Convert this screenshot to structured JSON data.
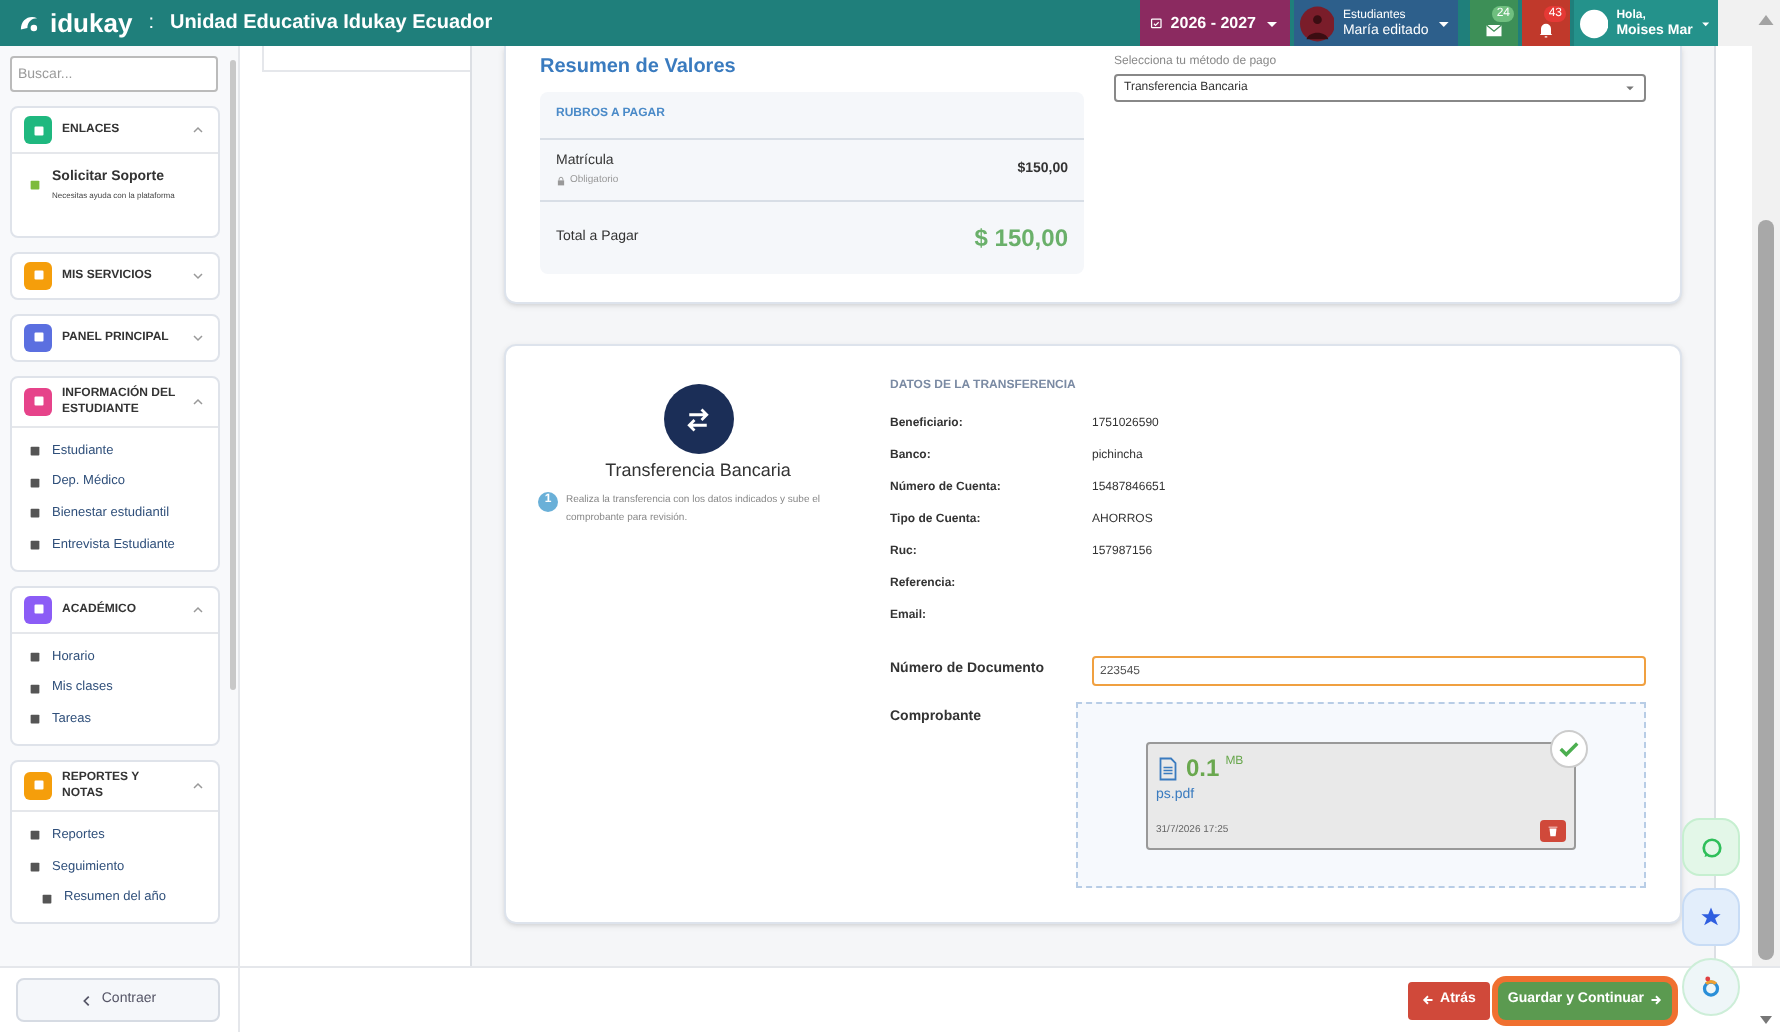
{
  "header": {
    "app_name": "idukay",
    "separator": ":",
    "institution": "Unidad Educativa Idukay Ecuador",
    "year": "2026 - 2027",
    "student_label": "Estudiantes",
    "student_name": "María editado",
    "messages_count": "24",
    "notifications_count": "43",
    "greeting": "Hola,",
    "user_name": "Moises Mar"
  },
  "sidebar": {
    "search": {
      "placeholder": "Buscar..."
    },
    "sections": [
      {
        "title": "ENLACES",
        "color": "#1fb87f",
        "expanded": true,
        "items": [
          {
            "label": "Solicitar Soporte",
            "subtitle": "Necesitas ayuda con la plataforma"
          }
        ]
      },
      {
        "title": "MIS SERVICIOS",
        "color": "#f59e0b",
        "expanded": false
      },
      {
        "title": "PANEL PRINCIPAL",
        "color": "#5b6fe0",
        "expanded": false
      },
      {
        "title": "INFORMACIÓN DEL ESTUDIANTE",
        "color": "#e6438a",
        "expanded": true,
        "items": [
          {
            "label": "Estudiante"
          },
          {
            "label": "Dep. Médico"
          },
          {
            "label": "Bienestar estudiantil"
          },
          {
            "label": "Entrevista Estudiante"
          }
        ]
      },
      {
        "title": "ACADÉMICO",
        "color": "#8b5cf6",
        "expanded": true,
        "items": [
          {
            "label": "Horario"
          },
          {
            "label": "Mis clases"
          },
          {
            "label": "Tareas"
          }
        ]
      },
      {
        "title": "REPORTES Y NOTAS",
        "color": "#f59e0b",
        "expanded": true,
        "items": [
          {
            "label": "Reportes"
          },
          {
            "label": "Seguimiento",
            "children": [
              {
                "label": "Resumen del año"
              }
            ]
          }
        ]
      }
    ],
    "collapse": "Contraer"
  },
  "summary": {
    "title": "Resumen de Valores",
    "table_heading": "RUBROS A PAGAR",
    "rows": [
      {
        "name": "Matrícula",
        "note": "Obligatorio",
        "amount": "$150,00"
      }
    ],
    "total_label": "Total a Pagar",
    "total": "$ 150,00",
    "payment_method": {
      "label": "Selecciona tu método de pago",
      "value": "Transferencia Bancaria"
    }
  },
  "transfer": {
    "title": "Transferencia Bancaria",
    "step": "1",
    "instruction": "Realiza la transferencia con los datos indicados y sube el comprobante para revisión.",
    "details_heading": "DATOS DE LA TRANSFERENCIA",
    "details": [
      {
        "label": "Beneficiario:",
        "value": "1751026590"
      },
      {
        "label": "Banco:",
        "value": "pichincha"
      },
      {
        "label": "Número de Cuenta:",
        "value": "15487846651"
      },
      {
        "label": "Tipo de Cuenta:",
        "value": "AHORROS"
      },
      {
        "label": "Ruc:",
        "value": "157987156"
      },
      {
        "label": "Referencia:"
      },
      {
        "label": "Email:"
      }
    ],
    "document": {
      "label": "Número de Documento",
      "value": "223545"
    },
    "receipt": {
      "label": "Comprobante",
      "size": "0.1",
      "unit": "MB",
      "filename": "ps.pdf",
      "date": "31/7/2026 17:25",
      "verified": true
    }
  },
  "footer": {
    "back": "Atrás",
    "save": "Guardar y Continuar"
  }
}
